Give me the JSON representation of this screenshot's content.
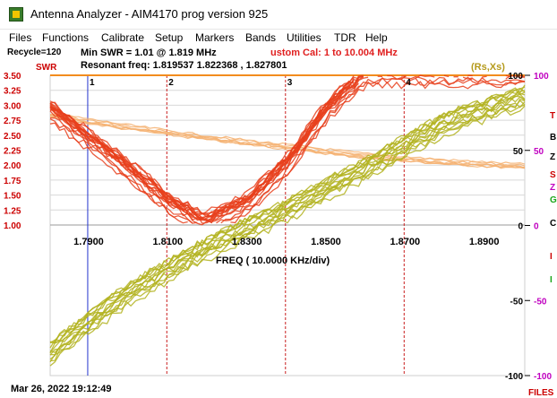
{
  "window": {
    "title": "Antenna Analyzer -  AIM4170     prog version 925"
  },
  "menu": [
    "Files",
    "Functions",
    "Calibrate",
    "Setup",
    "Markers",
    "Bands",
    "Utilities",
    "TDR",
    "Help"
  ],
  "info": {
    "recycle": "Recycle=120",
    "min_swr": "Min SWR =   1.01 @  1.819 MHz",
    "cal": "ustom Cal:  1 to 10.004 MHz",
    "resonant": "Resonant freq:  1.819537    1.822368 , 1.827801"
  },
  "plot": {
    "swr_label": "SWR",
    "rsxs_label": "(Rs,Xs)",
    "freq_axis_label": "FREQ (  10.0000 KHz/div)",
    "timestamp": "Mar 26, 2022  19:12:49",
    "files_label": "FILES",
    "swr_ticks": [
      "3.50",
      "3.25",
      "3.00",
      "2.75",
      "2.50",
      "2.25",
      "2.00",
      "1.75",
      "1.50",
      "1.25",
      "1.00"
    ],
    "freq_ticks": [
      "1.7900",
      "1.8100",
      "1.8300",
      "1.8500",
      "1.8700",
      "1.8900"
    ],
    "freq_ticks_partial_note": "1.8",
    "right_inner_ticks": [
      "100",
      "50",
      "0",
      "-50",
      "-100"
    ],
    "right_outer_ticks": [
      "100",
      "50",
      "0",
      "-50",
      "-100"
    ],
    "markers": [
      "1",
      "2",
      "3",
      "4"
    ],
    "colors": {
      "swr": "#e8401c",
      "rs": "#f5b070",
      "xs": "#b3b320",
      "marker_red": "#c81e1e",
      "marker_blue": "#2233cc",
      "grid": "#9a9a9a",
      "right_outer": "#c000c0",
      "orange_top": "#f28c1e"
    }
  },
  "chart_data": {
    "type": "line",
    "x_label": "FREQ (  10.0000 KHz/div)",
    "xlim": [
      1.78,
      1.9
    ],
    "swr_ylim": [
      1.0,
      3.5
    ],
    "rsxs_ylim": [
      -100,
      100
    ],
    "series": [
      {
        "name": "SWR",
        "x": [
          1.78,
          1.79,
          1.8,
          1.81,
          1.819,
          1.83,
          1.84,
          1.85,
          1.86
        ],
        "y": [
          2.9,
          2.4,
          1.9,
          1.35,
          1.01,
          1.35,
          2.0,
          2.9,
          3.5
        ]
      },
      {
        "name": "Rs",
        "x": [
          1.78,
          1.8,
          1.82,
          1.84,
          1.86,
          1.88,
          1.9
        ],
        "y": [
          74,
          66,
          59,
          53,
          47,
          43,
          40
        ]
      },
      {
        "name": "Xs",
        "x": [
          1.78,
          1.8,
          1.82,
          1.84,
          1.86,
          1.88,
          1.9
        ],
        "y": [
          -85,
          -45,
          -15,
          10,
          38,
          68,
          85
        ]
      }
    ],
    "marker_frequencies": [
      1.7895,
      1.8095,
      1.8395,
      1.8695
    ]
  }
}
